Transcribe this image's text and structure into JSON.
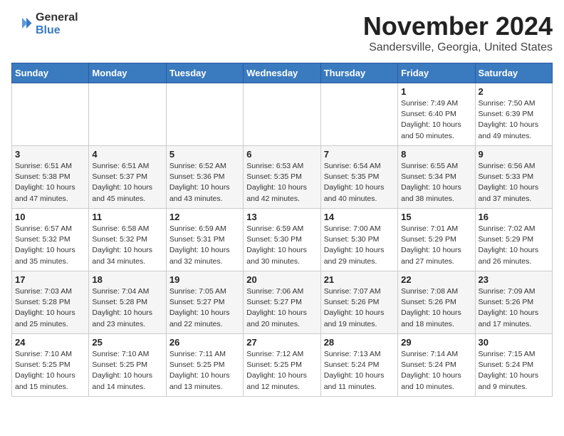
{
  "header": {
    "logo_general": "General",
    "logo_blue": "Blue",
    "month_title": "November 2024",
    "location": "Sandersville, Georgia, United States"
  },
  "weekdays": [
    "Sunday",
    "Monday",
    "Tuesday",
    "Wednesday",
    "Thursday",
    "Friday",
    "Saturday"
  ],
  "weeks": [
    [
      {
        "day": "",
        "info": ""
      },
      {
        "day": "",
        "info": ""
      },
      {
        "day": "",
        "info": ""
      },
      {
        "day": "",
        "info": ""
      },
      {
        "day": "",
        "info": ""
      },
      {
        "day": "1",
        "info": "Sunrise: 7:49 AM\nSunset: 6:40 PM\nDaylight: 10 hours and 50 minutes."
      },
      {
        "day": "2",
        "info": "Sunrise: 7:50 AM\nSunset: 6:39 PM\nDaylight: 10 hours and 49 minutes."
      }
    ],
    [
      {
        "day": "3",
        "info": "Sunrise: 6:51 AM\nSunset: 5:38 PM\nDaylight: 10 hours and 47 minutes."
      },
      {
        "day": "4",
        "info": "Sunrise: 6:51 AM\nSunset: 5:37 PM\nDaylight: 10 hours and 45 minutes."
      },
      {
        "day": "5",
        "info": "Sunrise: 6:52 AM\nSunset: 5:36 PM\nDaylight: 10 hours and 43 minutes."
      },
      {
        "day": "6",
        "info": "Sunrise: 6:53 AM\nSunset: 5:35 PM\nDaylight: 10 hours and 42 minutes."
      },
      {
        "day": "7",
        "info": "Sunrise: 6:54 AM\nSunset: 5:35 PM\nDaylight: 10 hours and 40 minutes."
      },
      {
        "day": "8",
        "info": "Sunrise: 6:55 AM\nSunset: 5:34 PM\nDaylight: 10 hours and 38 minutes."
      },
      {
        "day": "9",
        "info": "Sunrise: 6:56 AM\nSunset: 5:33 PM\nDaylight: 10 hours and 37 minutes."
      }
    ],
    [
      {
        "day": "10",
        "info": "Sunrise: 6:57 AM\nSunset: 5:32 PM\nDaylight: 10 hours and 35 minutes."
      },
      {
        "day": "11",
        "info": "Sunrise: 6:58 AM\nSunset: 5:32 PM\nDaylight: 10 hours and 34 minutes."
      },
      {
        "day": "12",
        "info": "Sunrise: 6:59 AM\nSunset: 5:31 PM\nDaylight: 10 hours and 32 minutes."
      },
      {
        "day": "13",
        "info": "Sunrise: 6:59 AM\nSunset: 5:30 PM\nDaylight: 10 hours and 30 minutes."
      },
      {
        "day": "14",
        "info": "Sunrise: 7:00 AM\nSunset: 5:30 PM\nDaylight: 10 hours and 29 minutes."
      },
      {
        "day": "15",
        "info": "Sunrise: 7:01 AM\nSunset: 5:29 PM\nDaylight: 10 hours and 27 minutes."
      },
      {
        "day": "16",
        "info": "Sunrise: 7:02 AM\nSunset: 5:29 PM\nDaylight: 10 hours and 26 minutes."
      }
    ],
    [
      {
        "day": "17",
        "info": "Sunrise: 7:03 AM\nSunset: 5:28 PM\nDaylight: 10 hours and 25 minutes."
      },
      {
        "day": "18",
        "info": "Sunrise: 7:04 AM\nSunset: 5:28 PM\nDaylight: 10 hours and 23 minutes."
      },
      {
        "day": "19",
        "info": "Sunrise: 7:05 AM\nSunset: 5:27 PM\nDaylight: 10 hours and 22 minutes."
      },
      {
        "day": "20",
        "info": "Sunrise: 7:06 AM\nSunset: 5:27 PM\nDaylight: 10 hours and 20 minutes."
      },
      {
        "day": "21",
        "info": "Sunrise: 7:07 AM\nSunset: 5:26 PM\nDaylight: 10 hours and 19 minutes."
      },
      {
        "day": "22",
        "info": "Sunrise: 7:08 AM\nSunset: 5:26 PM\nDaylight: 10 hours and 18 minutes."
      },
      {
        "day": "23",
        "info": "Sunrise: 7:09 AM\nSunset: 5:26 PM\nDaylight: 10 hours and 17 minutes."
      }
    ],
    [
      {
        "day": "24",
        "info": "Sunrise: 7:10 AM\nSunset: 5:25 PM\nDaylight: 10 hours and 15 minutes."
      },
      {
        "day": "25",
        "info": "Sunrise: 7:10 AM\nSunset: 5:25 PM\nDaylight: 10 hours and 14 minutes."
      },
      {
        "day": "26",
        "info": "Sunrise: 7:11 AM\nSunset: 5:25 PM\nDaylight: 10 hours and 13 minutes."
      },
      {
        "day": "27",
        "info": "Sunrise: 7:12 AM\nSunset: 5:25 PM\nDaylight: 10 hours and 12 minutes."
      },
      {
        "day": "28",
        "info": "Sunrise: 7:13 AM\nSunset: 5:24 PM\nDaylight: 10 hours and 11 minutes."
      },
      {
        "day": "29",
        "info": "Sunrise: 7:14 AM\nSunset: 5:24 PM\nDaylight: 10 hours and 10 minutes."
      },
      {
        "day": "30",
        "info": "Sunrise: 7:15 AM\nSunset: 5:24 PM\nDaylight: 10 hours and 9 minutes."
      }
    ]
  ]
}
